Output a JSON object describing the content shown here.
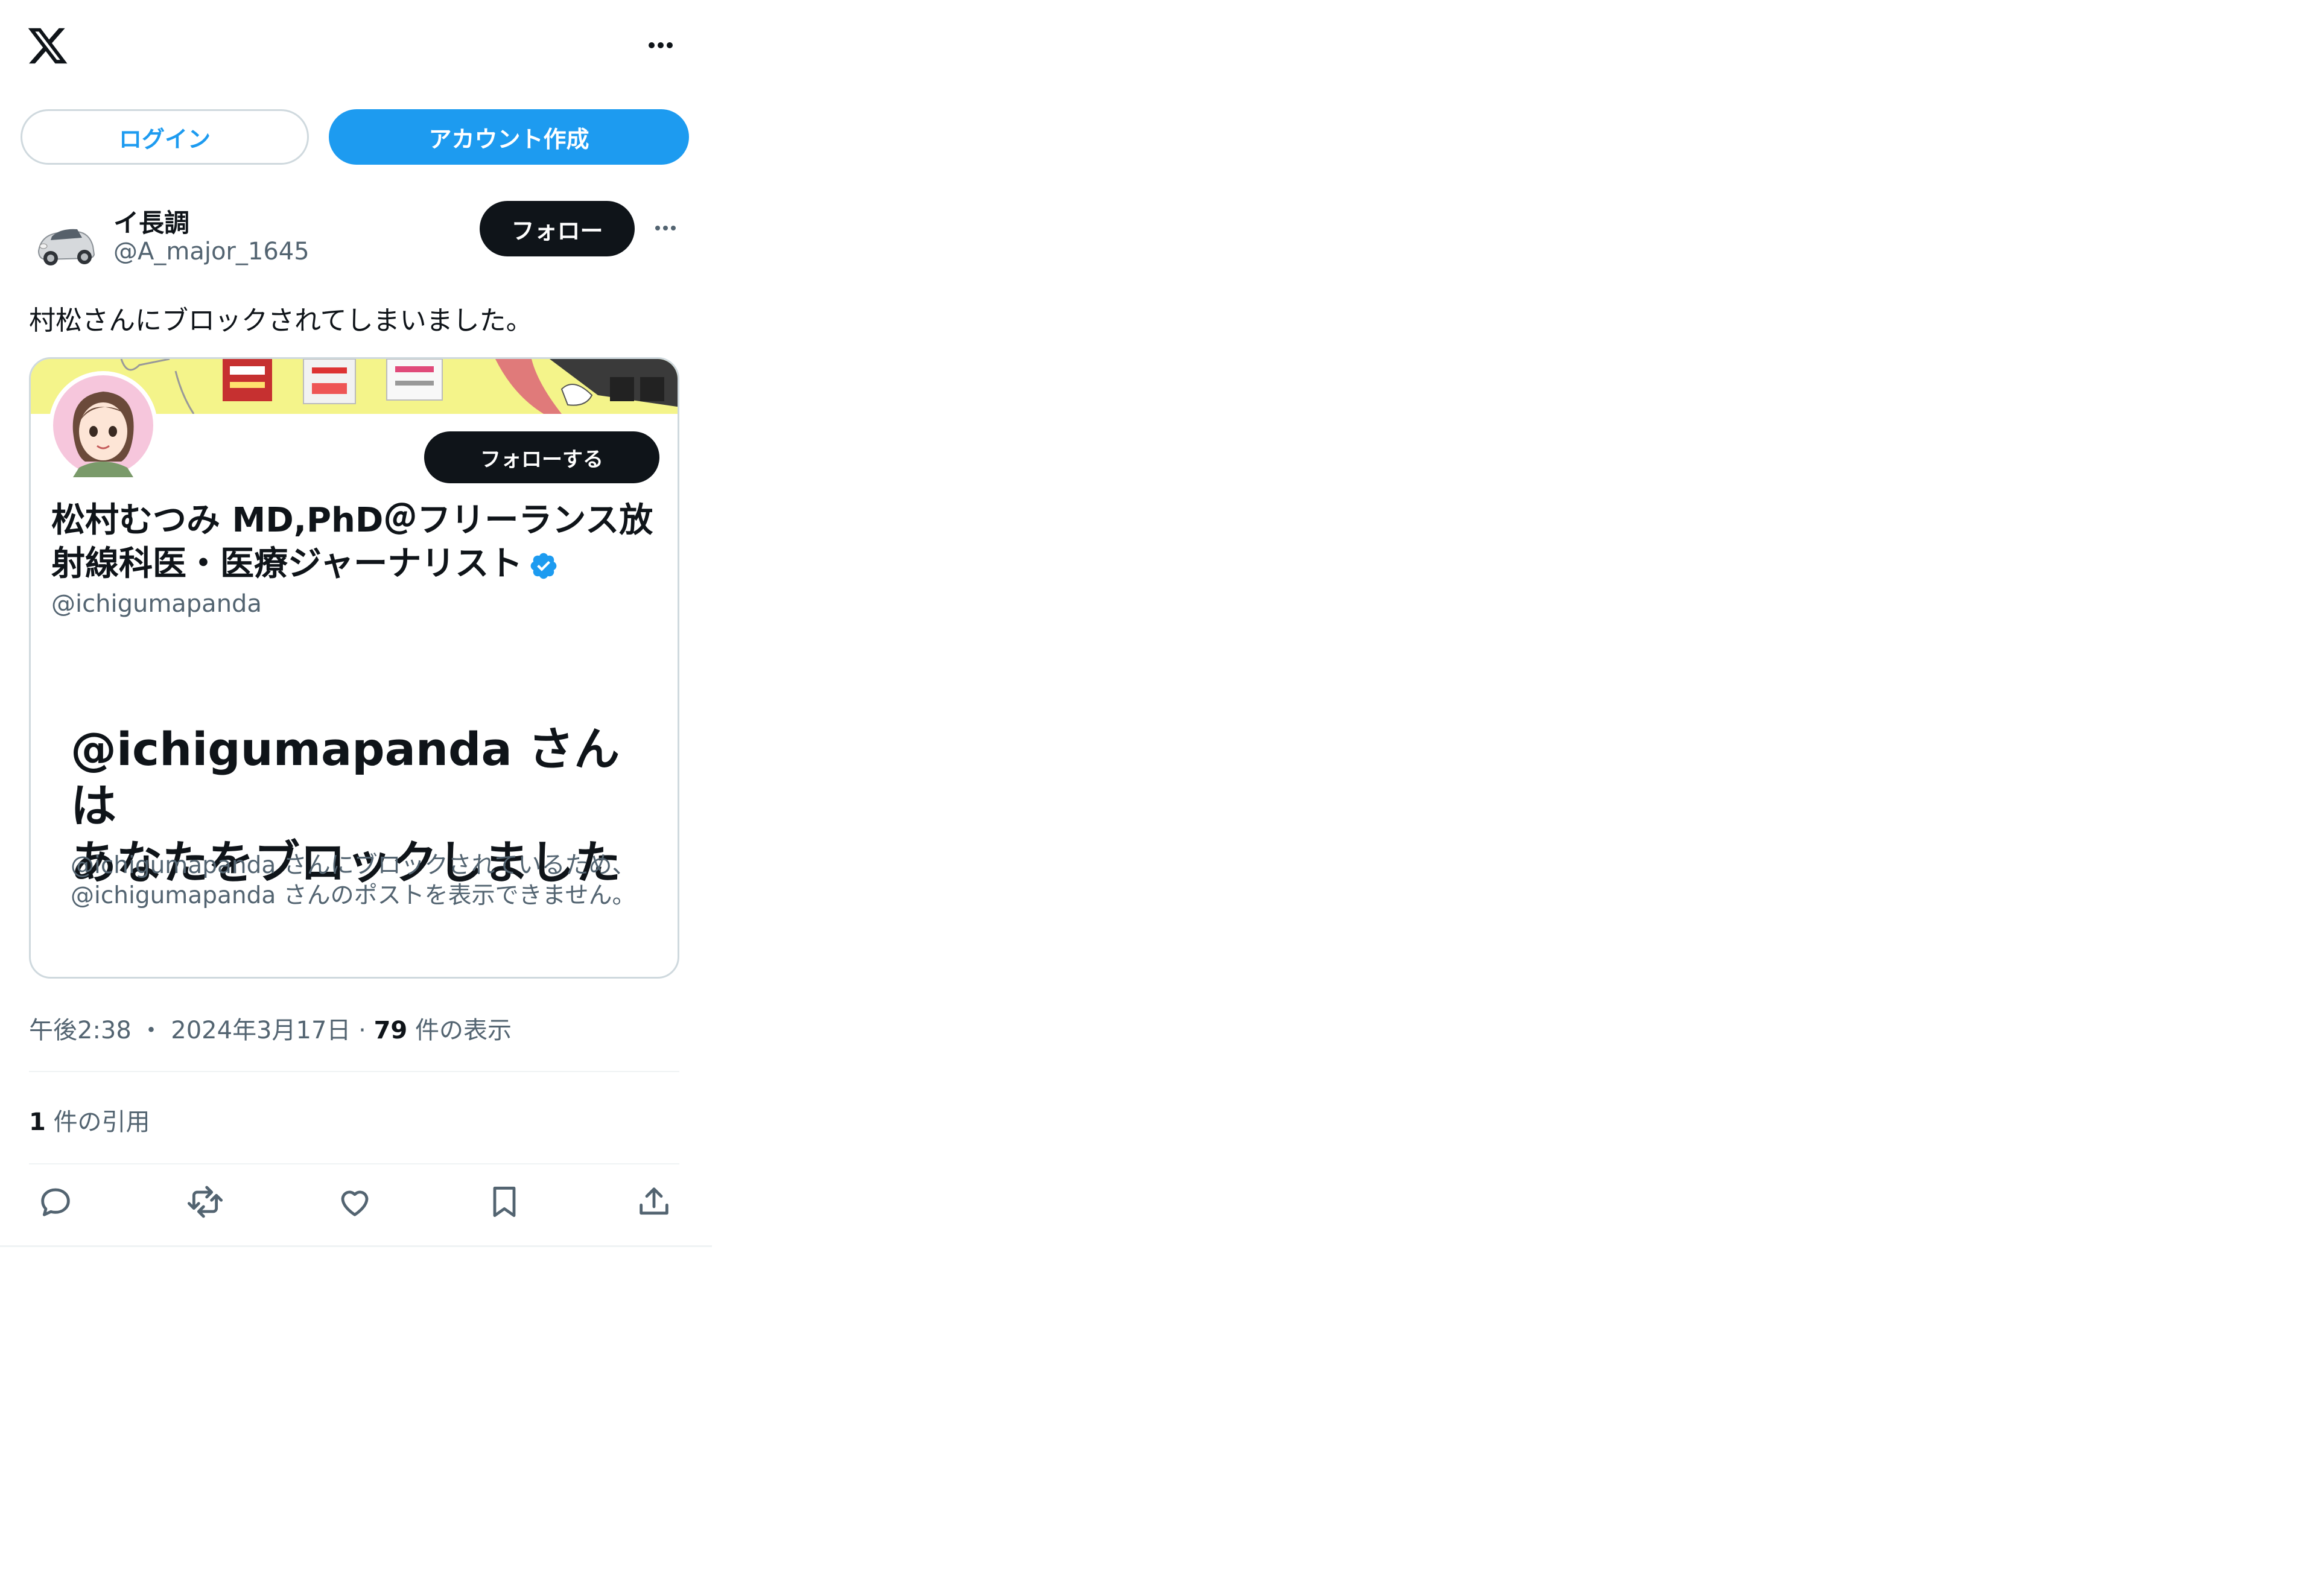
{
  "header": {
    "logo_icon": "x-logo-icon",
    "more_icon": "more-horizontal-icon"
  },
  "auth": {
    "login_label": "ログイン",
    "signup_label": "アカウント作成"
  },
  "post": {
    "author_name": "イ長調",
    "author_handle": "@A_major_1645",
    "follow_label": "フォロー",
    "text": "村松さんにブロックされてしまいました。",
    "embedded": {
      "follow_label": "フォローする",
      "profile_name": "松村むつみ MD,PhD＠フリーランス放射線科医・医療ジャーナリスト",
      "profile_handle": "@ichigumapanda",
      "blocked_title_line1": "@ichigumapanda さんは",
      "blocked_title_line2": "あなたをブロックしました",
      "blocked_desc_line1": "@ichigumapanda さんにブロックされているため、",
      "blocked_desc_line2": "@ichigumapanda さんのポストを表示できません。"
    },
    "time": "午後2:38",
    "date": "2024年3月17日",
    "views_count": "79",
    "views_label": "件の表示",
    "quotes_count": "1",
    "quotes_label": "件の引用"
  },
  "colors": {
    "accent": "#1d9bf0",
    "text": "#0f1419",
    "muted": "#536471",
    "border": "#cfd9de"
  }
}
